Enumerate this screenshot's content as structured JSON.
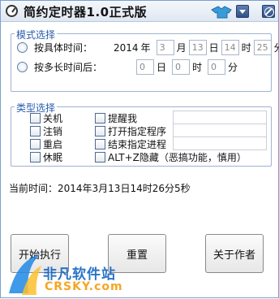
{
  "window": {
    "title": "简约定时器1.0正式版"
  },
  "mode_group": {
    "legend": "模式选择",
    "specific_label": "按具体时间：",
    "year": "2014",
    "year_unit": "年",
    "month": "3",
    "month_unit": "月",
    "day": "13",
    "day_unit": "日",
    "hour": "14",
    "hour_unit": "时",
    "minute": "25",
    "minute_unit": "分",
    "delay_label": "按多长时间后：",
    "delay_days": "0",
    "delay_days_unit": "日",
    "delay_hours": "0",
    "delay_hours_unit": "时",
    "delay_minutes": "0",
    "delay_minutes_unit": "分"
  },
  "type_group": {
    "legend": "类型选择",
    "shutdown": "关机",
    "logoff": "注销",
    "restart": "重启",
    "hibernate": "休眠",
    "remind": "提醒我",
    "open_program": "打开指定程序",
    "kill_process": "结束指定进程",
    "alt_z": "ALT+Z隐藏（恶搞功能，慎用）"
  },
  "status": {
    "current_time": "当前时间：2014年3月13日14时26分5秒"
  },
  "buttons": {
    "start": "开始执行",
    "reset": "重置",
    "about": "关于作者"
  },
  "watermark": {
    "text": "非凡软件站",
    "domain": "CRSKY.com"
  },
  "colors": {
    "accent": "#2a5db0",
    "border": "#9fb3cf",
    "watermark_blue": "#1565c0",
    "watermark_orange": "#f5a623"
  }
}
